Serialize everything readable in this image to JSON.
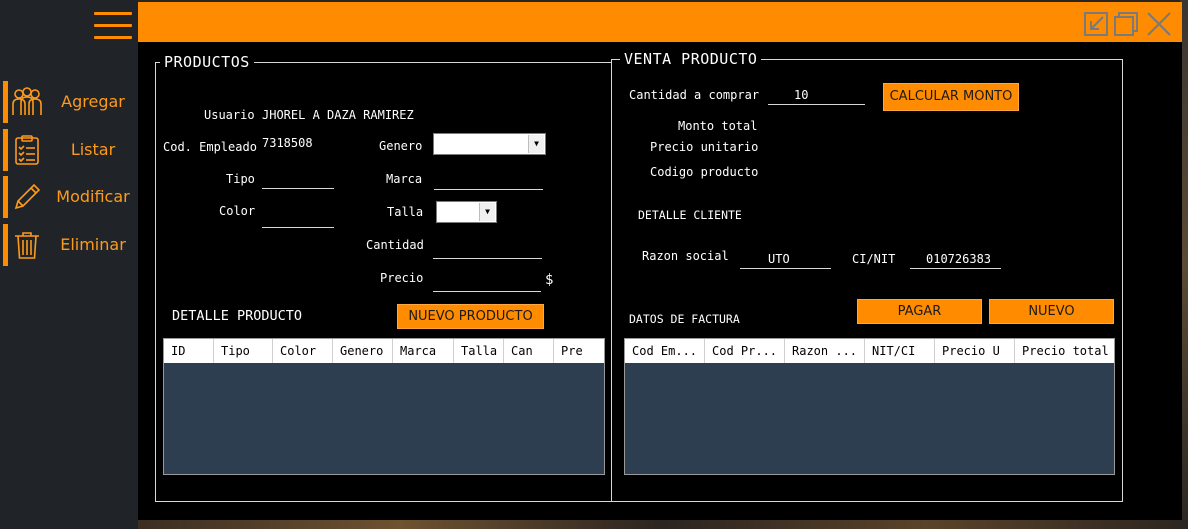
{
  "sidebar": {
    "items": [
      {
        "label": "Agregar",
        "icon": "users-icon"
      },
      {
        "label": "Listar",
        "icon": "checklist-icon"
      },
      {
        "label": "Modificar",
        "icon": "pencil-icon"
      },
      {
        "label": "Eliminar",
        "icon": "trash-icon"
      }
    ]
  },
  "colors": {
    "accent": "#ff8c00",
    "table_bg": "#2c3e50",
    "panel_bg": "#000000"
  },
  "productos": {
    "legend": "PRODUCTOS",
    "usuario_label": "Usuario",
    "usuario_value": "JHOREL A DAZA RAMIREZ",
    "cod_empleado_label": "Cod. Empleado",
    "cod_empleado_value": "7318508",
    "genero_label": "Genero",
    "genero_value": "",
    "tipo_label": "Tipo",
    "tipo_value": "",
    "marca_label": "Marca",
    "marca_value": "",
    "color_label": "Color",
    "color_value": "",
    "talla_label": "Talla",
    "talla_value": "",
    "cantidad_label": "Cantidad",
    "cantidad_value": "",
    "precio_label": "Precio",
    "precio_value": "",
    "currency": "$",
    "detalle_label": "DETALLE PRODUCTO",
    "nuevo_producto_button": "NUEVO PRODUCTO",
    "table_columns": [
      "ID",
      "Tipo",
      "Color",
      "Genero",
      "Marca",
      "Talla",
      "Can",
      "Pre"
    ]
  },
  "venta": {
    "legend": "VENTA PRODUCTO",
    "cantidad_label": "Cantidad a comprar",
    "cantidad_value": "10",
    "calcular_button": "CALCULAR MONTO",
    "monto_label": "Monto total",
    "precio_unitario_label": "Precio unitario",
    "codigo_producto_label": "Codigo producto",
    "detalle_cliente_label": "DETALLE CLIENTE",
    "razon_label": "Razon social",
    "razon_value": "UTO",
    "cinit_label": "CI/NIT",
    "cinit_value": "010726383",
    "pagar_button": "PAGAR",
    "nuevo_button": "NUEVO",
    "datos_label": "DATOS DE FACTURA",
    "table_columns": [
      "Cod Em...",
      "Cod Pr...",
      "Razon ...",
      "NIT/CI",
      "Precio U",
      "Precio total"
    ]
  }
}
